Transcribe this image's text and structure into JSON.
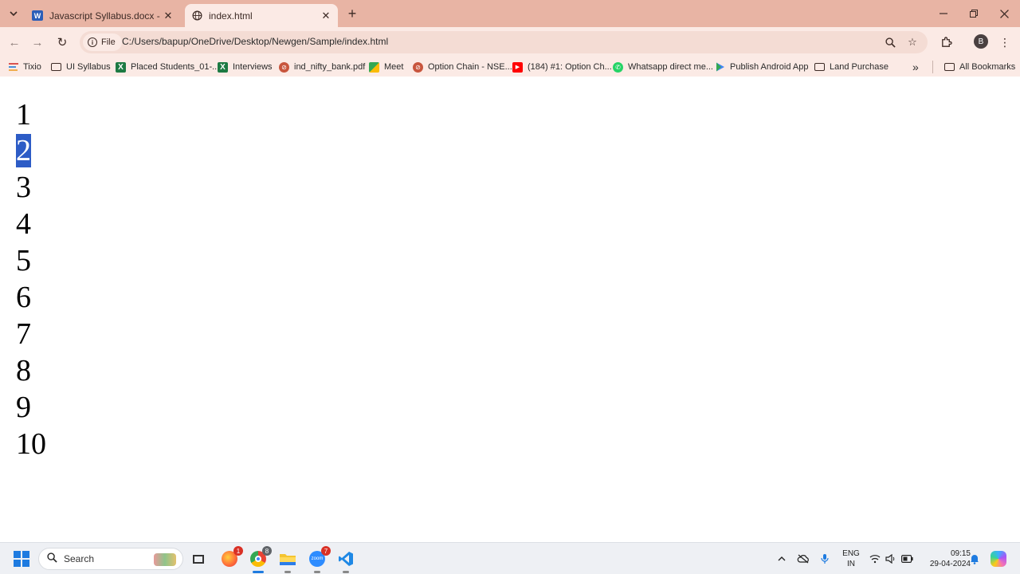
{
  "browser": {
    "tabs": [
      {
        "title": "Javascript Syllabus.docx - Microsoft Word",
        "icon": "word-icon",
        "active": false
      },
      {
        "title": "index.html",
        "icon": "globe-icon",
        "active": true
      }
    ],
    "address_bar": {
      "scheme_chip": "File",
      "url": "C:/Users/bapup/OneDrive/Desktop/Newgen/Sample/index.html"
    },
    "profile_initial": "B",
    "bookmarks": [
      {
        "label": "Tixio",
        "icon": "apps-icon"
      },
      {
        "label": "UI Syllabus",
        "icon": "folder-icon"
      },
      {
        "label": "Placed Students_01-...",
        "icon": "excel-icon"
      },
      {
        "label": "Interviews",
        "icon": "excel-icon"
      },
      {
        "label": "ind_nifty_bank.pdf",
        "icon": "pdf-icon"
      },
      {
        "label": "Meet",
        "icon": "meet-icon"
      },
      {
        "label": "Option Chain - NSE...",
        "icon": "nse-icon"
      },
      {
        "label": "(184) #1: Option Ch...",
        "icon": "youtube-icon"
      },
      {
        "label": "Whatsapp direct me...",
        "icon": "whatsapp-icon"
      },
      {
        "label": "Publish Android App",
        "icon": "play-icon"
      },
      {
        "label": "Land Purchase",
        "icon": "folder-icon"
      }
    ],
    "all_bookmarks_label": "All Bookmarks",
    "theme_color": "#e8b4a4"
  },
  "page": {
    "numbers": [
      "1",
      "2",
      "3",
      "4",
      "5",
      "6",
      "7",
      "8",
      "9",
      "10"
    ],
    "selected_number": "2",
    "selection_color": "#2d5cc6"
  },
  "taskbar": {
    "search_placeholder": "Search",
    "notification_badges": {
      "browser_profile": "1",
      "chrome": "8",
      "zoom": "7"
    },
    "language": {
      "line1": "ENG",
      "line2": "IN"
    },
    "time": "09:15",
    "date": "29-04-2024"
  }
}
